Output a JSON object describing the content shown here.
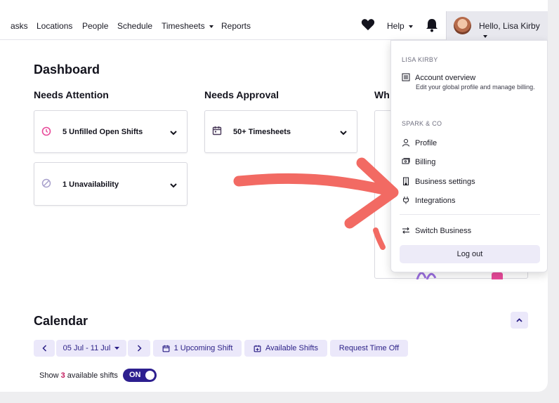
{
  "nav": {
    "links": [
      "asks",
      "Locations",
      "People",
      "Schedule",
      "Timesheets",
      "Reports"
    ],
    "help": "Help",
    "user_greeting": "Hello, Lisa Kirby"
  },
  "dashboard": {
    "title": "Dashboard",
    "needs_attention": "Needs Attention",
    "needs_approval": "Needs Approval",
    "third_column_partial": "Wh",
    "cards": {
      "unfilled": "5 Unfilled Open Shifts",
      "unavailability": "1 Unavailability",
      "timesheets": "50+ Timesheets"
    }
  },
  "calendar": {
    "title": "Calendar",
    "date_range": "05 Jul - 11 Jul",
    "upcoming": "1 Upcoming Shift",
    "available": "Available Shifts",
    "request_time_off": "Request Time Off",
    "show_prefix": "Show",
    "show_count": "3",
    "show_suffix": "available shifts",
    "toggle": "ON"
  },
  "menu": {
    "user_section": "LISA KIRBY",
    "account_overview": "Account overview",
    "account_desc": "Edit your global profile and manage billing.",
    "business_section": "SPARK & CO",
    "profile": "Profile",
    "billing": "Billing",
    "business_settings": "Business settings",
    "integrations": "Integrations",
    "switch_business": "Switch Business",
    "logout": "Log out"
  },
  "colors": {
    "accent": "#2d1f8f",
    "pill_bg": "#ebe8fa",
    "arrow": "#f26a63",
    "pink_icon": "#e84a9a"
  }
}
